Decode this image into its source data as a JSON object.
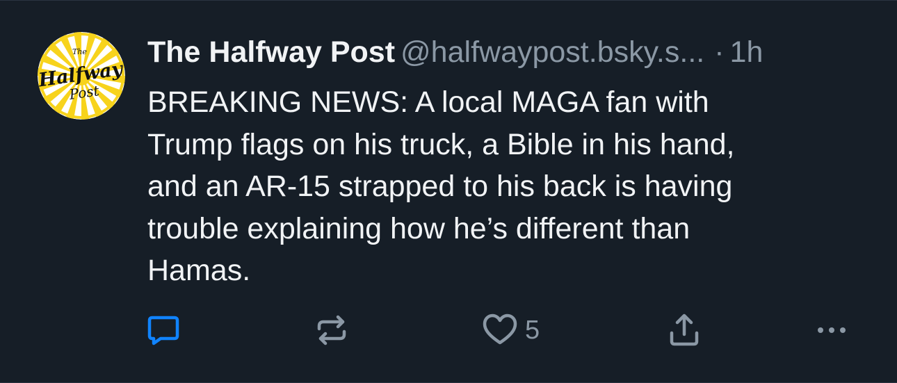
{
  "post": {
    "author": {
      "display_name": "The Halfway Post",
      "handle": "@halfwaypost.bsky.s...",
      "avatar_logo": {
        "top": "The",
        "middle": "Halfway",
        "bottom": "Post"
      }
    },
    "separator": "·",
    "time": "1h",
    "text": "BREAKING NEWS: A local MAGA fan with\nTrump flags on his truck, a Bible in his hand,\nand an AR-15 strapped to his back is having\ntrouble explaining how he’s different than\nHamas.",
    "actions": {
      "reply_icon": "comment-icon",
      "repost_icon": "repost-icon",
      "like_icon": "heart-icon",
      "like_count": "5",
      "share_icon": "share-icon",
      "more_icon": "more-dots-icon"
    }
  },
  "colors": {
    "background": "#161e27",
    "text_primary": "#f1f3f5",
    "text_secondary": "#8b98a5",
    "reply_icon": "#1083fe",
    "icon_default": "#8b98a5",
    "avatar_yellow": "#f7d31c"
  }
}
